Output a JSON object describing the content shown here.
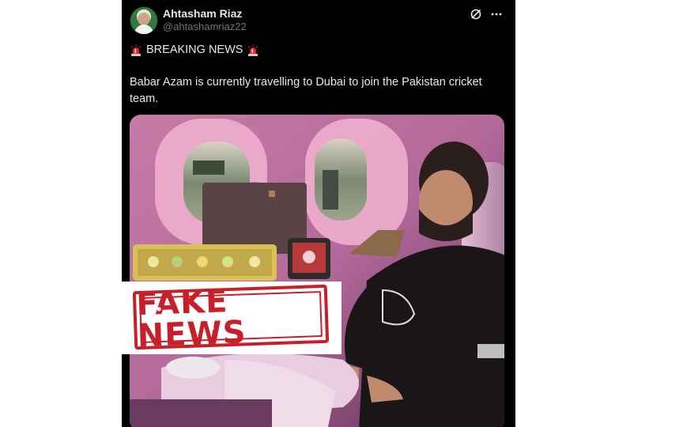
{
  "post": {
    "author": {
      "display_name": "Ahtasham Riaz",
      "handle": "@ahtashamriaz22",
      "avatar": "avatar-image"
    },
    "header_icons": [
      "grok-icon",
      "more-options-icon"
    ],
    "headline": "BREAKING NEWS",
    "headline_icon": "police-siren-emoji",
    "body": "Babar Azam is currently travelling to Dubai to join the Pakistan cricket team.",
    "media": {
      "description_icon": "airplane-cabin-photo"
    }
  },
  "overlay": {
    "stamp_text": "FAKE NEWS",
    "stamp_color": "#c8202a"
  },
  "colors": {
    "card_background": "#000000",
    "text_primary": "#e7e9ea",
    "text_secondary": "#71767b",
    "page_background": "#ffffff"
  }
}
